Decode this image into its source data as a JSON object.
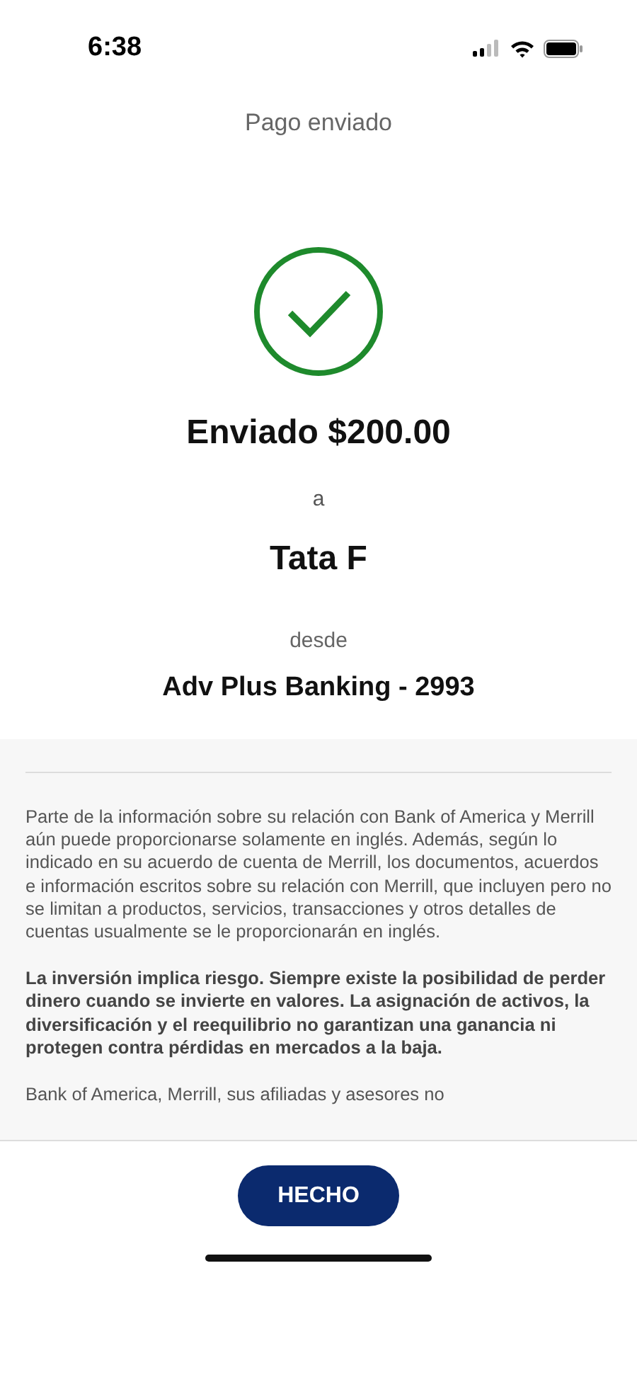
{
  "status_bar": {
    "time": "6:38"
  },
  "header": {
    "title": "Pago enviado"
  },
  "confirmation": {
    "amount": "Enviado $200.00",
    "to_label": "a",
    "recipient": "Tata F",
    "from_label": "desde",
    "account": "Adv Plus Banking - 2993"
  },
  "disclosures": [
    {
      "kind": "normal",
      "text": "Parte de la información sobre su relación con Bank of America y Merrill aún puede proporcionarse solamente en inglés. Además, según lo indicado en su acuerdo de cuenta de Merrill, los documentos, acuerdos e información escritos sobre su relación con Merrill, que incluyen pero no se limitan a productos, servicios, transacciones y otros detalles de cuentas usualmente se le proporcionarán en inglés."
    },
    {
      "kind": "bold",
      "text": "La inversión implica riesgo. Siempre existe la posibilidad de perder dinero cuando se invierte en valores. La asignación de activos, la diversificación y el reequilibrio no garantizan una ganancia ni protegen contra pérdidas en mercados a la baja."
    },
    {
      "kind": "normal",
      "text": "Bank of America, Merrill, sus afiliadas y asesores no"
    }
  ],
  "footer": {
    "button": "HECHO"
  }
}
